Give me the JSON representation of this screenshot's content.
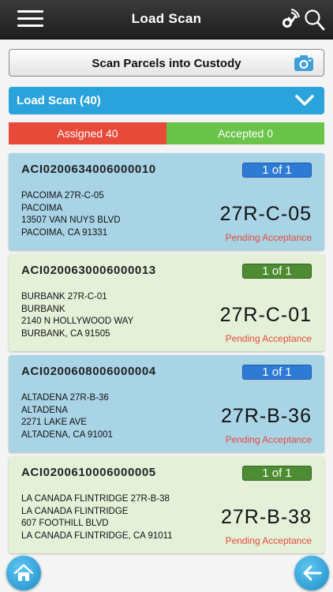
{
  "header": {
    "title": "Load Scan",
    "icons": [
      "menu-icon",
      "scan-signal-icon",
      "search-icon"
    ]
  },
  "scan_button": {
    "label": "Scan Parcels into Custody",
    "icon": "camera-icon"
  },
  "load_header": {
    "label": "Load Scan (40)",
    "icon": "chevron-down-icon"
  },
  "status": {
    "assigned_label": "Assigned 40",
    "accepted_label": "Accepted 0",
    "assigned_color": "#e84a3a",
    "accepted_color": "#6ac44a"
  },
  "cards": [
    {
      "id": "ACI0200634006000010",
      "badge": "1 of 1",
      "lines": [
        "PACOIMA 27R-C-05",
        "PACOIMA",
        "13507 VAN NUYS BLVD",
        "PACOIMA, CA 91331"
      ],
      "code": "27R-C-05",
      "status": "Pending Acceptance",
      "color": "blue"
    },
    {
      "id": "ACI0200630006000013",
      "badge": "1 of 1",
      "lines": [
        "BURBANK 27R-C-01",
        "BURBANK",
        "2140 N HOLLYWOOD WAY",
        "BURBANK, CA 91505"
      ],
      "code": "27R-C-01",
      "status": "Pending Acceptance",
      "color": "green"
    },
    {
      "id": "ACI0200608006000004",
      "badge": "1 of 1",
      "lines": [
        "ALTADENA 27R-B-36",
        "ALTADENA",
        "2271 LAKE AVE",
        "ALTADENA, CA 91001"
      ],
      "code": "27R-B-36",
      "status": "Pending Acceptance",
      "color": "blue"
    },
    {
      "id": "ACI0200610006000005",
      "badge": "1 of 1",
      "lines": [
        "LA CANADA FLINTRIDGE 27R-B-38",
        "LA CANADA FLINTRIDGE",
        "607 FOOTHILL BLVD",
        "LA CANADA FLINTRIDGE, CA 91011"
      ],
      "code": "27R-B-38",
      "status": "Pending Acceptance",
      "color": "green"
    }
  ],
  "footer": {
    "icons": [
      "home-icon",
      "back-arrow-icon"
    ]
  }
}
